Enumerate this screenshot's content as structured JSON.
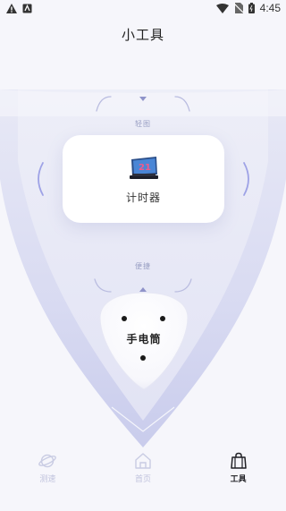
{
  "status_bar": {
    "time": "4:45",
    "left_icons": [
      "warning-icon",
      "notification-icon"
    ],
    "right_icons": [
      "wifi-icon",
      "no-sim-icon",
      "battery-icon"
    ]
  },
  "header": {
    "title": "小工具"
  },
  "wheel": {
    "top_label": "轻图",
    "bottom_label": "便捷",
    "prev_icon": "chevron-left-icon",
    "next_icon": "chevron-right-icon"
  },
  "selected_tool": {
    "label": "计时器",
    "icon": "counter-display-icon",
    "icon_number": "21"
  },
  "next_tool": {
    "label": "手电筒"
  },
  "bottom_nav": {
    "items": [
      {
        "label": "测速",
        "icon": "planet-icon",
        "active": false
      },
      {
        "label": "首页",
        "icon": "home-icon",
        "active": false
      },
      {
        "label": "工具",
        "icon": "bag-icon",
        "active": true
      }
    ]
  },
  "colors": {
    "accent": "#9ea2e6",
    "background": "#f6f6fb",
    "active_nav": "#1f1f24",
    "inactive_nav": "#c0c3dd"
  }
}
